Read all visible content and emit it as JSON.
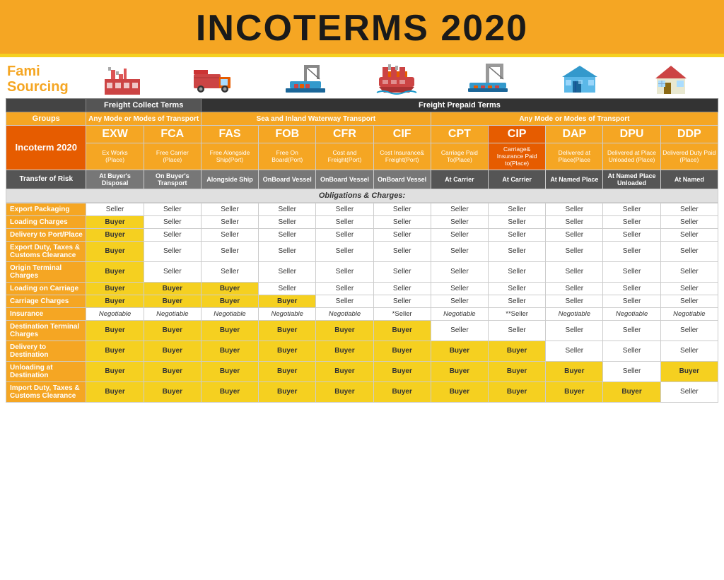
{
  "title": "INCOTERMS 2020",
  "logo": {
    "line1": "Fami",
    "line2": "Sourcing"
  },
  "freight_sections": {
    "collect": "Freight Collect Terms",
    "prepaid": "Freight Prepaid Terms"
  },
  "transport_modes": {
    "any1": "Any Mode or Modes of Transport",
    "sea": "Sea and Inland Waterway Transport",
    "any2": "Any Mode or Modes of Transport"
  },
  "incoterms": [
    {
      "code": "EXW",
      "name": "Ex Works",
      "place": "(Place)",
      "risk": "At Buyer's Disposal"
    },
    {
      "code": "FCA",
      "name": "Free Carrier",
      "place": "(Place)",
      "risk": "On Buyer's Transport"
    },
    {
      "code": "FAS",
      "name": "Free Alongside Ship",
      "place": "(Port)",
      "risk": "Alongside Ship"
    },
    {
      "code": "FOB",
      "name": "Free On Board",
      "place": "(Port)",
      "risk": "OnBoard Vessel"
    },
    {
      "code": "CFR",
      "name": "Cost and Freight",
      "place": "(Port)",
      "risk": "OnBoard Vessel"
    },
    {
      "code": "CIF",
      "name": "Cost Insurance& Freight",
      "place": "(Port)",
      "risk": "OnBoard Vessel"
    },
    {
      "code": "CPT",
      "name": "Carriage Paid To",
      "place": "(Place)",
      "risk": "At Carrier"
    },
    {
      "code": "CIP",
      "name": "Carriage& Insurance Paid to",
      "place": "(Place)",
      "risk": "At Carrier"
    },
    {
      "code": "DAP",
      "name": "Delivered at Place",
      "place": "(Place",
      "risk": "At Named Place"
    },
    {
      "code": "DPU",
      "name": "Delivered at Place Unloaded",
      "place": "(Place)",
      "risk": "At Named Place Unloaded"
    },
    {
      "code": "DDP",
      "name": "Delivered Duty Paid",
      "place": "(Place)",
      "risk": "At Named"
    }
  ],
  "groups_label": "Groups",
  "incoterm_label": "Incoterm\n2020",
  "transfer_risk_label": "Transfer of Risk",
  "obligations_header": "Obligations & Charges:",
  "rows": [
    {
      "label": "Export Packaging",
      "values": [
        "Seller",
        "Seller",
        "Seller",
        "Seller",
        "Seller",
        "Seller",
        "Seller",
        "Seller",
        "Seller",
        "Seller",
        "Seller"
      ]
    },
    {
      "label": "Loading Charges",
      "values": [
        "Buyer",
        "Seller",
        "Seller",
        "Seller",
        "Seller",
        "Seller",
        "Seller",
        "Seller",
        "Seller",
        "Seller",
        "Seller"
      ]
    },
    {
      "label": "Delivery to Port/Place",
      "values": [
        "Buyer",
        "Seller",
        "Seller",
        "Seller",
        "Seller",
        "Seller",
        "Seller",
        "Seller",
        "Seller",
        "Seller",
        "Seller"
      ]
    },
    {
      "label": "Export Duty, Taxes & Customs Clearance",
      "values": [
        "Buyer",
        "Seller",
        "Seller",
        "Seller",
        "Seller",
        "Seller",
        "Seller",
        "Seller",
        "Seller",
        "Seller",
        "Seller"
      ]
    },
    {
      "label": "Origin Terminal Charges",
      "values": [
        "Buyer",
        "Seller",
        "Seller",
        "Seller",
        "Seller",
        "Seller",
        "Seller",
        "Seller",
        "Seller",
        "Seller",
        "Seller"
      ]
    },
    {
      "label": "Loading on Carriage",
      "values": [
        "Buyer",
        "Buyer",
        "Buyer",
        "Seller",
        "Seller",
        "Seller",
        "Seller",
        "Seller",
        "Seller",
        "Seller",
        "Seller"
      ]
    },
    {
      "label": "Carriage Charges",
      "values": [
        "Buyer",
        "Buyer",
        "Buyer",
        "Buyer",
        "Seller",
        "Seller",
        "Seller",
        "Seller",
        "Seller",
        "Seller",
        "Seller"
      ]
    },
    {
      "label": "Insurance",
      "values": [
        "Negotiable",
        "Negotiable",
        "Negotiable",
        "Negotiable",
        "Negotiable",
        "*Seller",
        "Negotiable",
        "**Seller",
        "Negotiable",
        "Negotiable",
        "Negotiable"
      ]
    },
    {
      "label": "Destination Terminal Charges",
      "values": [
        "Buyer",
        "Buyer",
        "Buyer",
        "Buyer",
        "Buyer",
        "Buyer",
        "Seller",
        "Seller",
        "Seller",
        "Seller",
        "Seller"
      ]
    },
    {
      "label": "Delivery to Destination",
      "values": [
        "Buyer",
        "Buyer",
        "Buyer",
        "Buyer",
        "Buyer",
        "Buyer",
        "Buyer",
        "Buyer",
        "Seller",
        "Seller",
        "Seller"
      ]
    },
    {
      "label": "Unloading at Destination",
      "values": [
        "Buyer",
        "Buyer",
        "Buyer",
        "Buyer",
        "Buyer",
        "Buyer",
        "Buyer",
        "Buyer",
        "Buyer",
        "Seller",
        "Buyer"
      ]
    },
    {
      "label": "Import Duty, Taxes & Customs Clearance",
      "values": [
        "Buyer",
        "Buyer",
        "Buyer",
        "Buyer",
        "Buyer",
        "Buyer",
        "Buyer",
        "Buyer",
        "Buyer",
        "Buyer",
        "Seller"
      ]
    }
  ]
}
